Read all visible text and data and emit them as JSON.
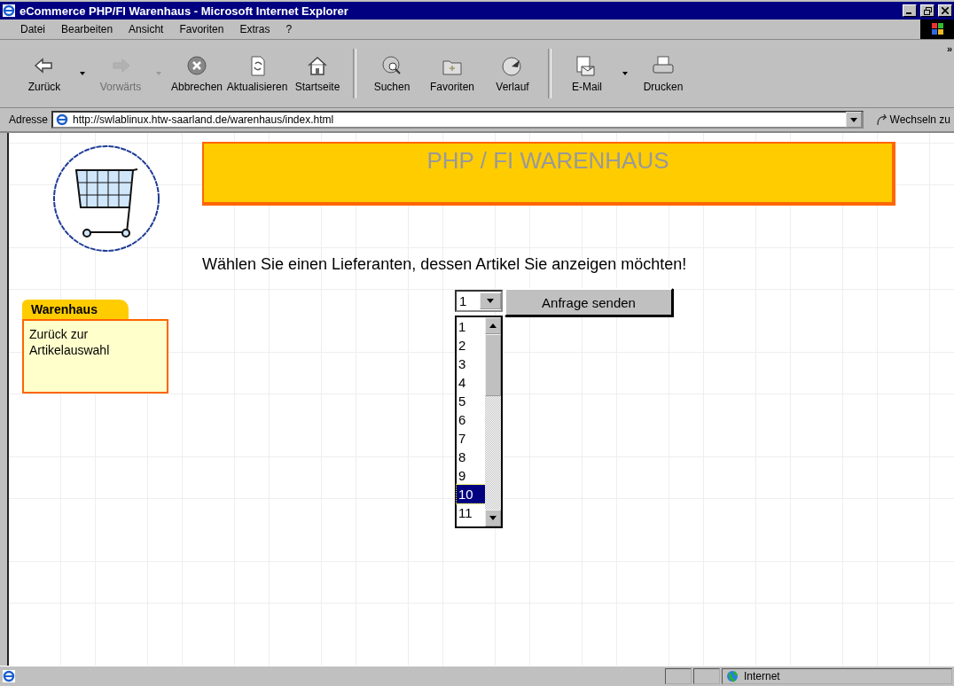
{
  "window": {
    "title": "eCommerce PHP/FI Warenhaus - Microsoft Internet Explorer"
  },
  "menu": [
    "Datei",
    "Bearbeiten",
    "Ansicht",
    "Favoriten",
    "Extras",
    "?"
  ],
  "toolbar": [
    {
      "kind": "back",
      "label": "Zurück",
      "disabled": false,
      "dropdown": true
    },
    {
      "kind": "forward",
      "label": "Vorwärts",
      "disabled": true,
      "dropdown": true
    },
    {
      "kind": "stop",
      "label": "Abbrechen",
      "disabled": false,
      "dropdown": false
    },
    {
      "kind": "refresh",
      "label": "Aktualisieren",
      "disabled": false,
      "dropdown": false
    },
    {
      "kind": "home",
      "label": "Startseite",
      "disabled": false,
      "dropdown": false
    },
    {
      "kind": "separator"
    },
    {
      "kind": "search",
      "label": "Suchen",
      "disabled": false,
      "dropdown": false
    },
    {
      "kind": "favorites",
      "label": "Favoriten",
      "disabled": false,
      "dropdown": false
    },
    {
      "kind": "history",
      "label": "Verlauf",
      "disabled": false,
      "dropdown": false
    },
    {
      "kind": "separator"
    },
    {
      "kind": "mail",
      "label": "E-Mail",
      "disabled": false,
      "dropdown": true
    },
    {
      "kind": "print",
      "label": "Drucken",
      "disabled": false,
      "dropdown": false
    }
  ],
  "toolbar_more": "»",
  "address": {
    "label": "Adresse",
    "value": "http://swlablinux.htw-saarland.de/warenhaus/index.html",
    "go": "Wechseln zu"
  },
  "page": {
    "banner": "PHP / FI WARENHAUS",
    "sidebar": {
      "tab": "Warenhaus",
      "link": "Zurück zur Artikelauswahl"
    },
    "heading": "Wählen Sie einen Lieferanten, dessen Artikel Sie anzeigen möchten!",
    "select": {
      "value": "1",
      "expanded": true
    },
    "submit": "Anfrage senden",
    "options": [
      {
        "label": "1",
        "selected": false
      },
      {
        "label": "2",
        "selected": false
      },
      {
        "label": "3",
        "selected": false
      },
      {
        "label": "4",
        "selected": false
      },
      {
        "label": "5",
        "selected": false
      },
      {
        "label": "6",
        "selected": false
      },
      {
        "label": "7",
        "selected": false
      },
      {
        "label": "8",
        "selected": false
      },
      {
        "label": "9",
        "selected": false
      },
      {
        "label": "10",
        "selected": true
      },
      {
        "label": "11",
        "selected": false
      }
    ]
  },
  "status_bar": {
    "zone": "Internet"
  }
}
